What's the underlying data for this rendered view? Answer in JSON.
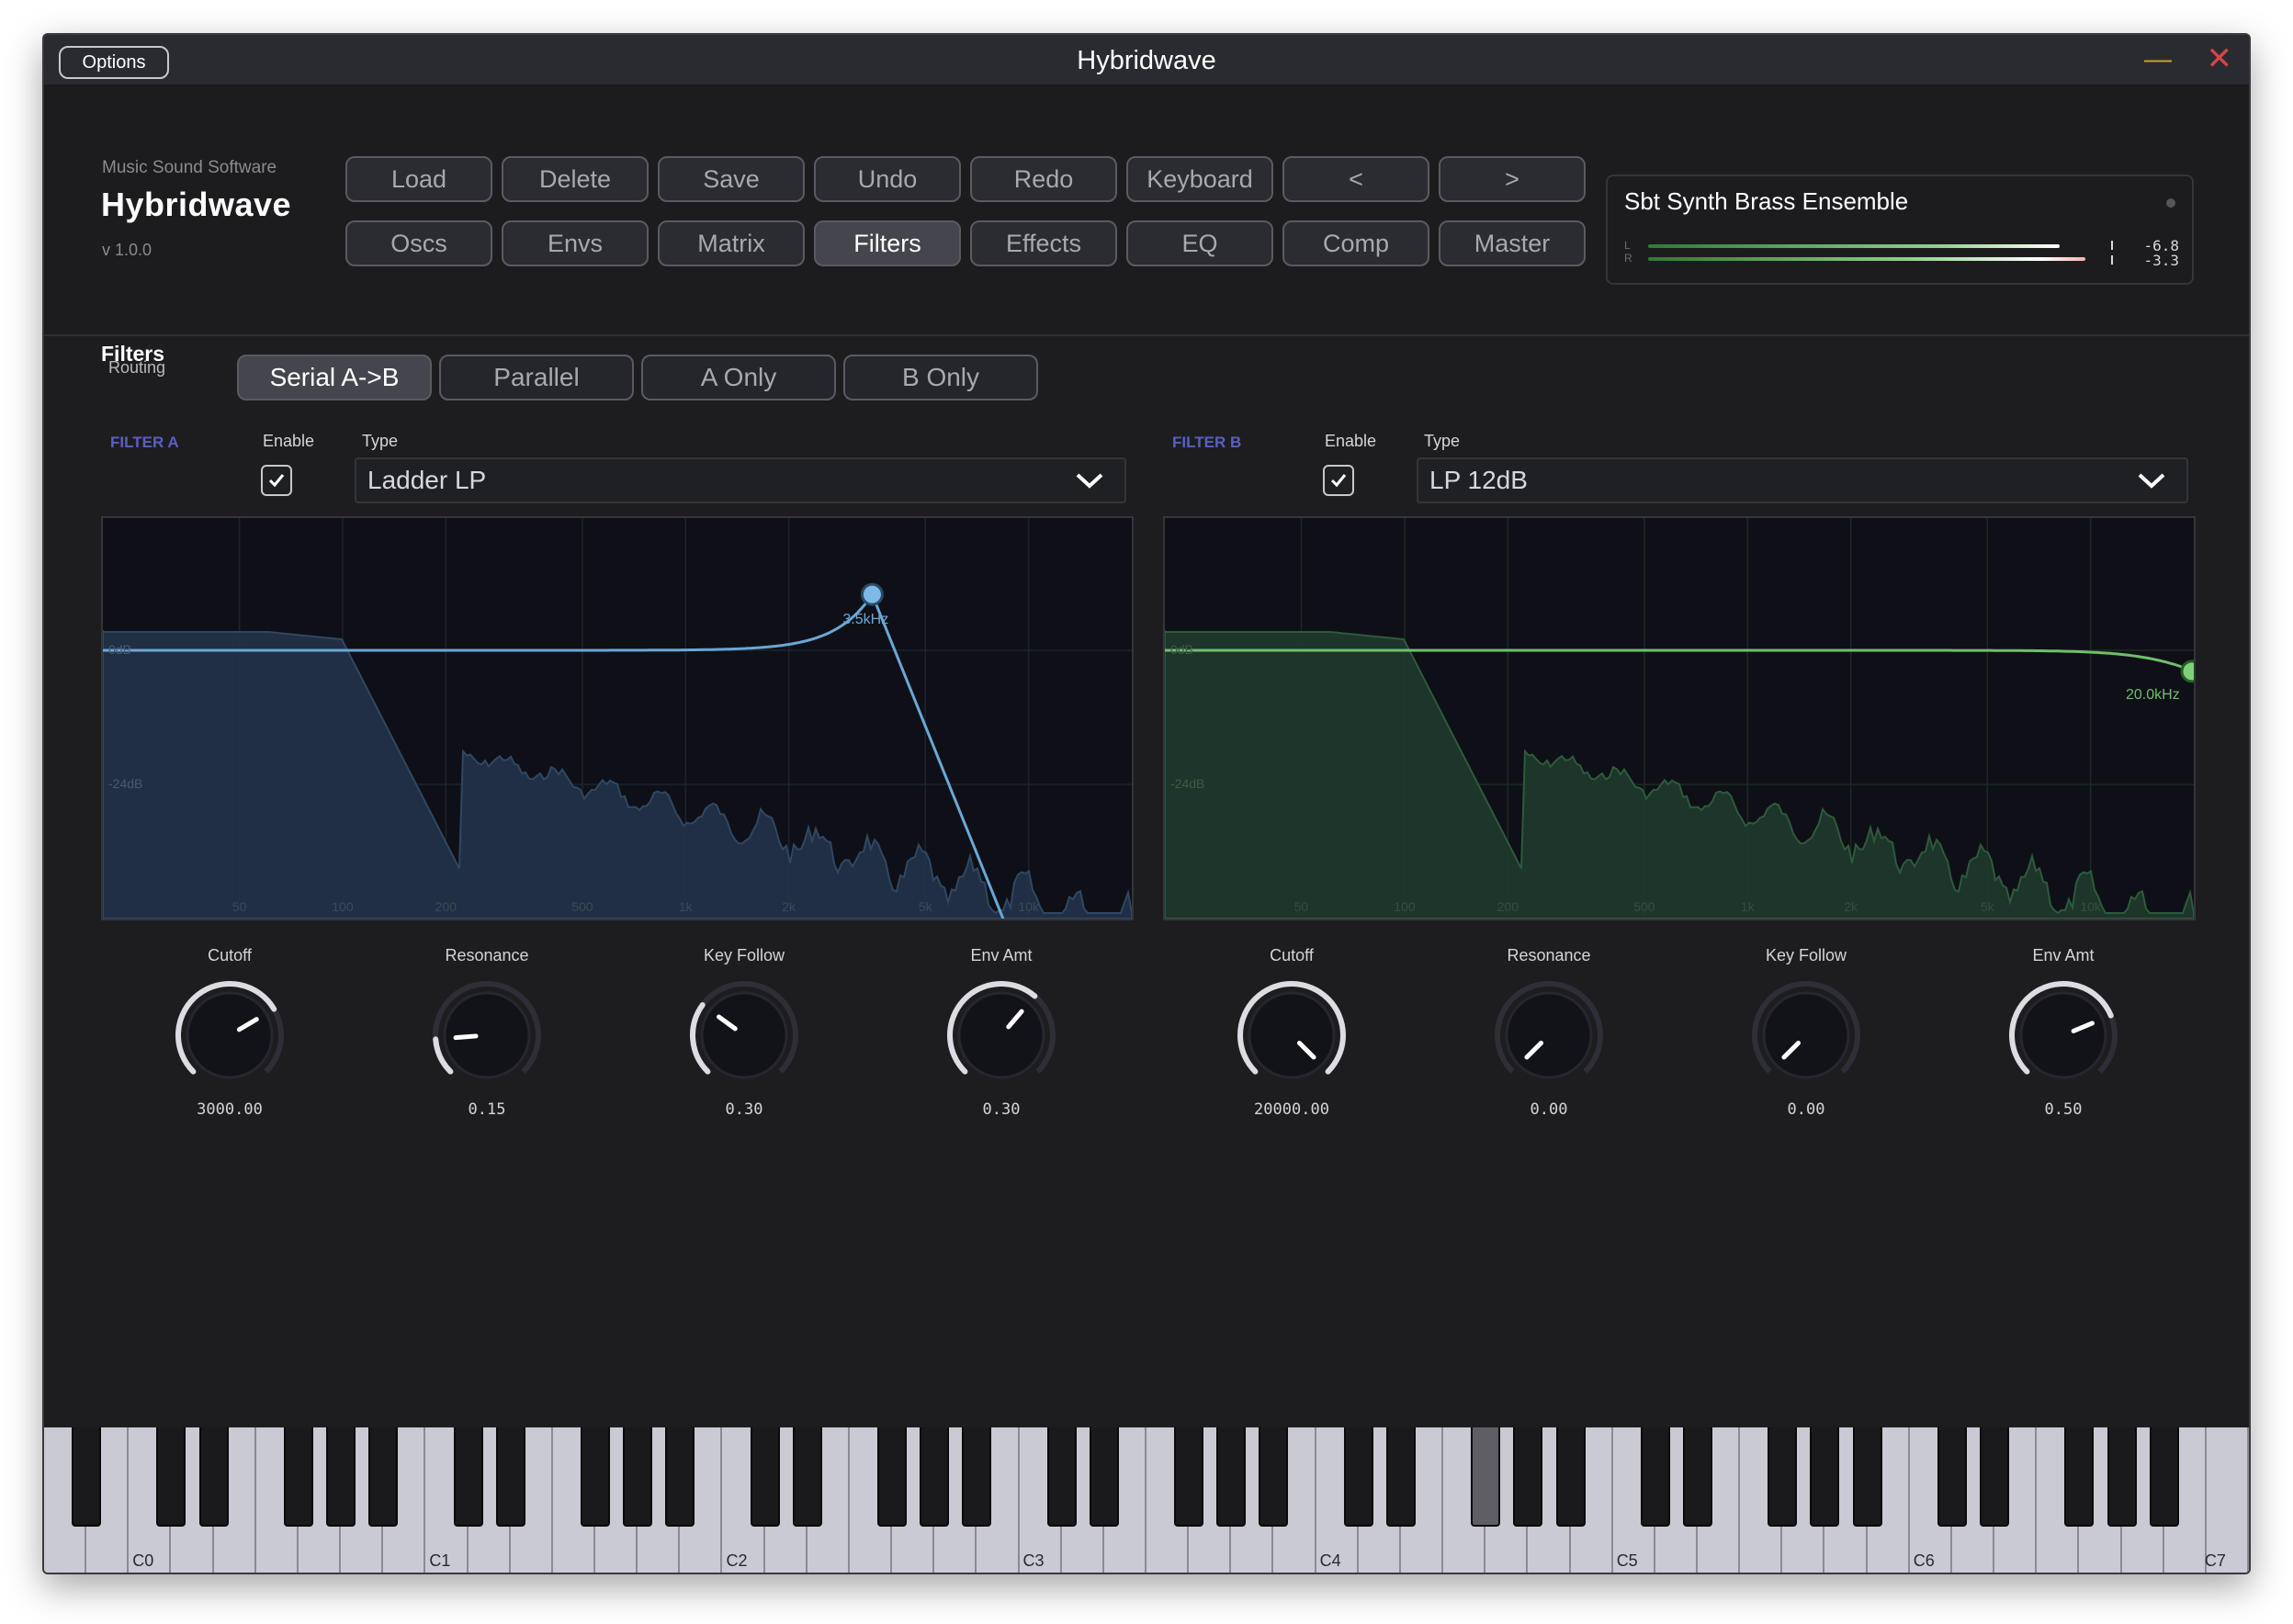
{
  "window": {
    "title": "Hybridwave",
    "options_label": "Options",
    "minimize_glyph": "—",
    "close_glyph": "✕"
  },
  "brand": {
    "company": "Music Sound Software",
    "name": "Hybridwave",
    "version": "v 1.0.0"
  },
  "toolbar": {
    "row1": [
      "Load",
      "Delete",
      "Save",
      "Undo",
      "Redo",
      "Keyboard",
      "<",
      ">"
    ],
    "row2": [
      "Oscs",
      "Envs",
      "Matrix",
      "Filters",
      "Effects",
      "EQ",
      "Comp",
      "Master"
    ],
    "active_tab": "Filters"
  },
  "preset": {
    "name": "Sbt Synth Brass Ensemble",
    "meter_left_label": "L",
    "meter_right_label": "R",
    "meter_left_value": "-6.8",
    "meter_right_value": "-3.3"
  },
  "section": {
    "title": "Filters"
  },
  "routing": {
    "label": "Routing",
    "options": [
      "Serial A->B",
      "Parallel",
      "A Only",
      "B Only"
    ],
    "selected": "Serial A->B"
  },
  "filter_a": {
    "name": "FILTER A",
    "enable_label": "Enable",
    "enabled": true,
    "type_label": "Type",
    "type": "Ladder LP",
    "graph": {
      "marker_label": "3.5kHz",
      "db_labels": [
        "0dB",
        "-24dB"
      ],
      "freq_labels": [
        "50",
        "100",
        "200",
        "500",
        "1k",
        "2k",
        "5k",
        "10k"
      ]
    },
    "knobs": [
      {
        "title": "Cutoff",
        "value": "3000.00"
      },
      {
        "title": "Resonance",
        "value": "0.15"
      },
      {
        "title": "Key Follow",
        "value": "0.30"
      },
      {
        "title": "Env Amt",
        "value": "0.30"
      }
    ]
  },
  "filter_b": {
    "name": "FILTER B",
    "enable_label": "Enable",
    "enabled": true,
    "type_label": "Type",
    "type": "LP 12dB",
    "graph": {
      "marker_label": "20.0kHz",
      "db_labels": [
        "0dB",
        "-24dB"
      ],
      "freq_labels": [
        "50",
        "100",
        "200",
        "500",
        "1k",
        "2k",
        "5k",
        "10k"
      ]
    },
    "knobs": [
      {
        "title": "Cutoff",
        "value": "20000.00"
      },
      {
        "title": "Resonance",
        "value": "0.00"
      },
      {
        "title": "Key Follow",
        "value": "0.00"
      },
      {
        "title": "Env Amt",
        "value": "0.50"
      }
    ]
  },
  "keyboard": {
    "octave_labels": [
      "C0",
      "C1",
      "C2",
      "C3",
      "C4",
      "C5",
      "C6",
      "C7"
    ]
  },
  "colors": {
    "accent_a": "#6aa7d6",
    "accent_b": "#6fbf6a",
    "filter_label": "#5a5fc4",
    "background": "#1d1d20"
  }
}
